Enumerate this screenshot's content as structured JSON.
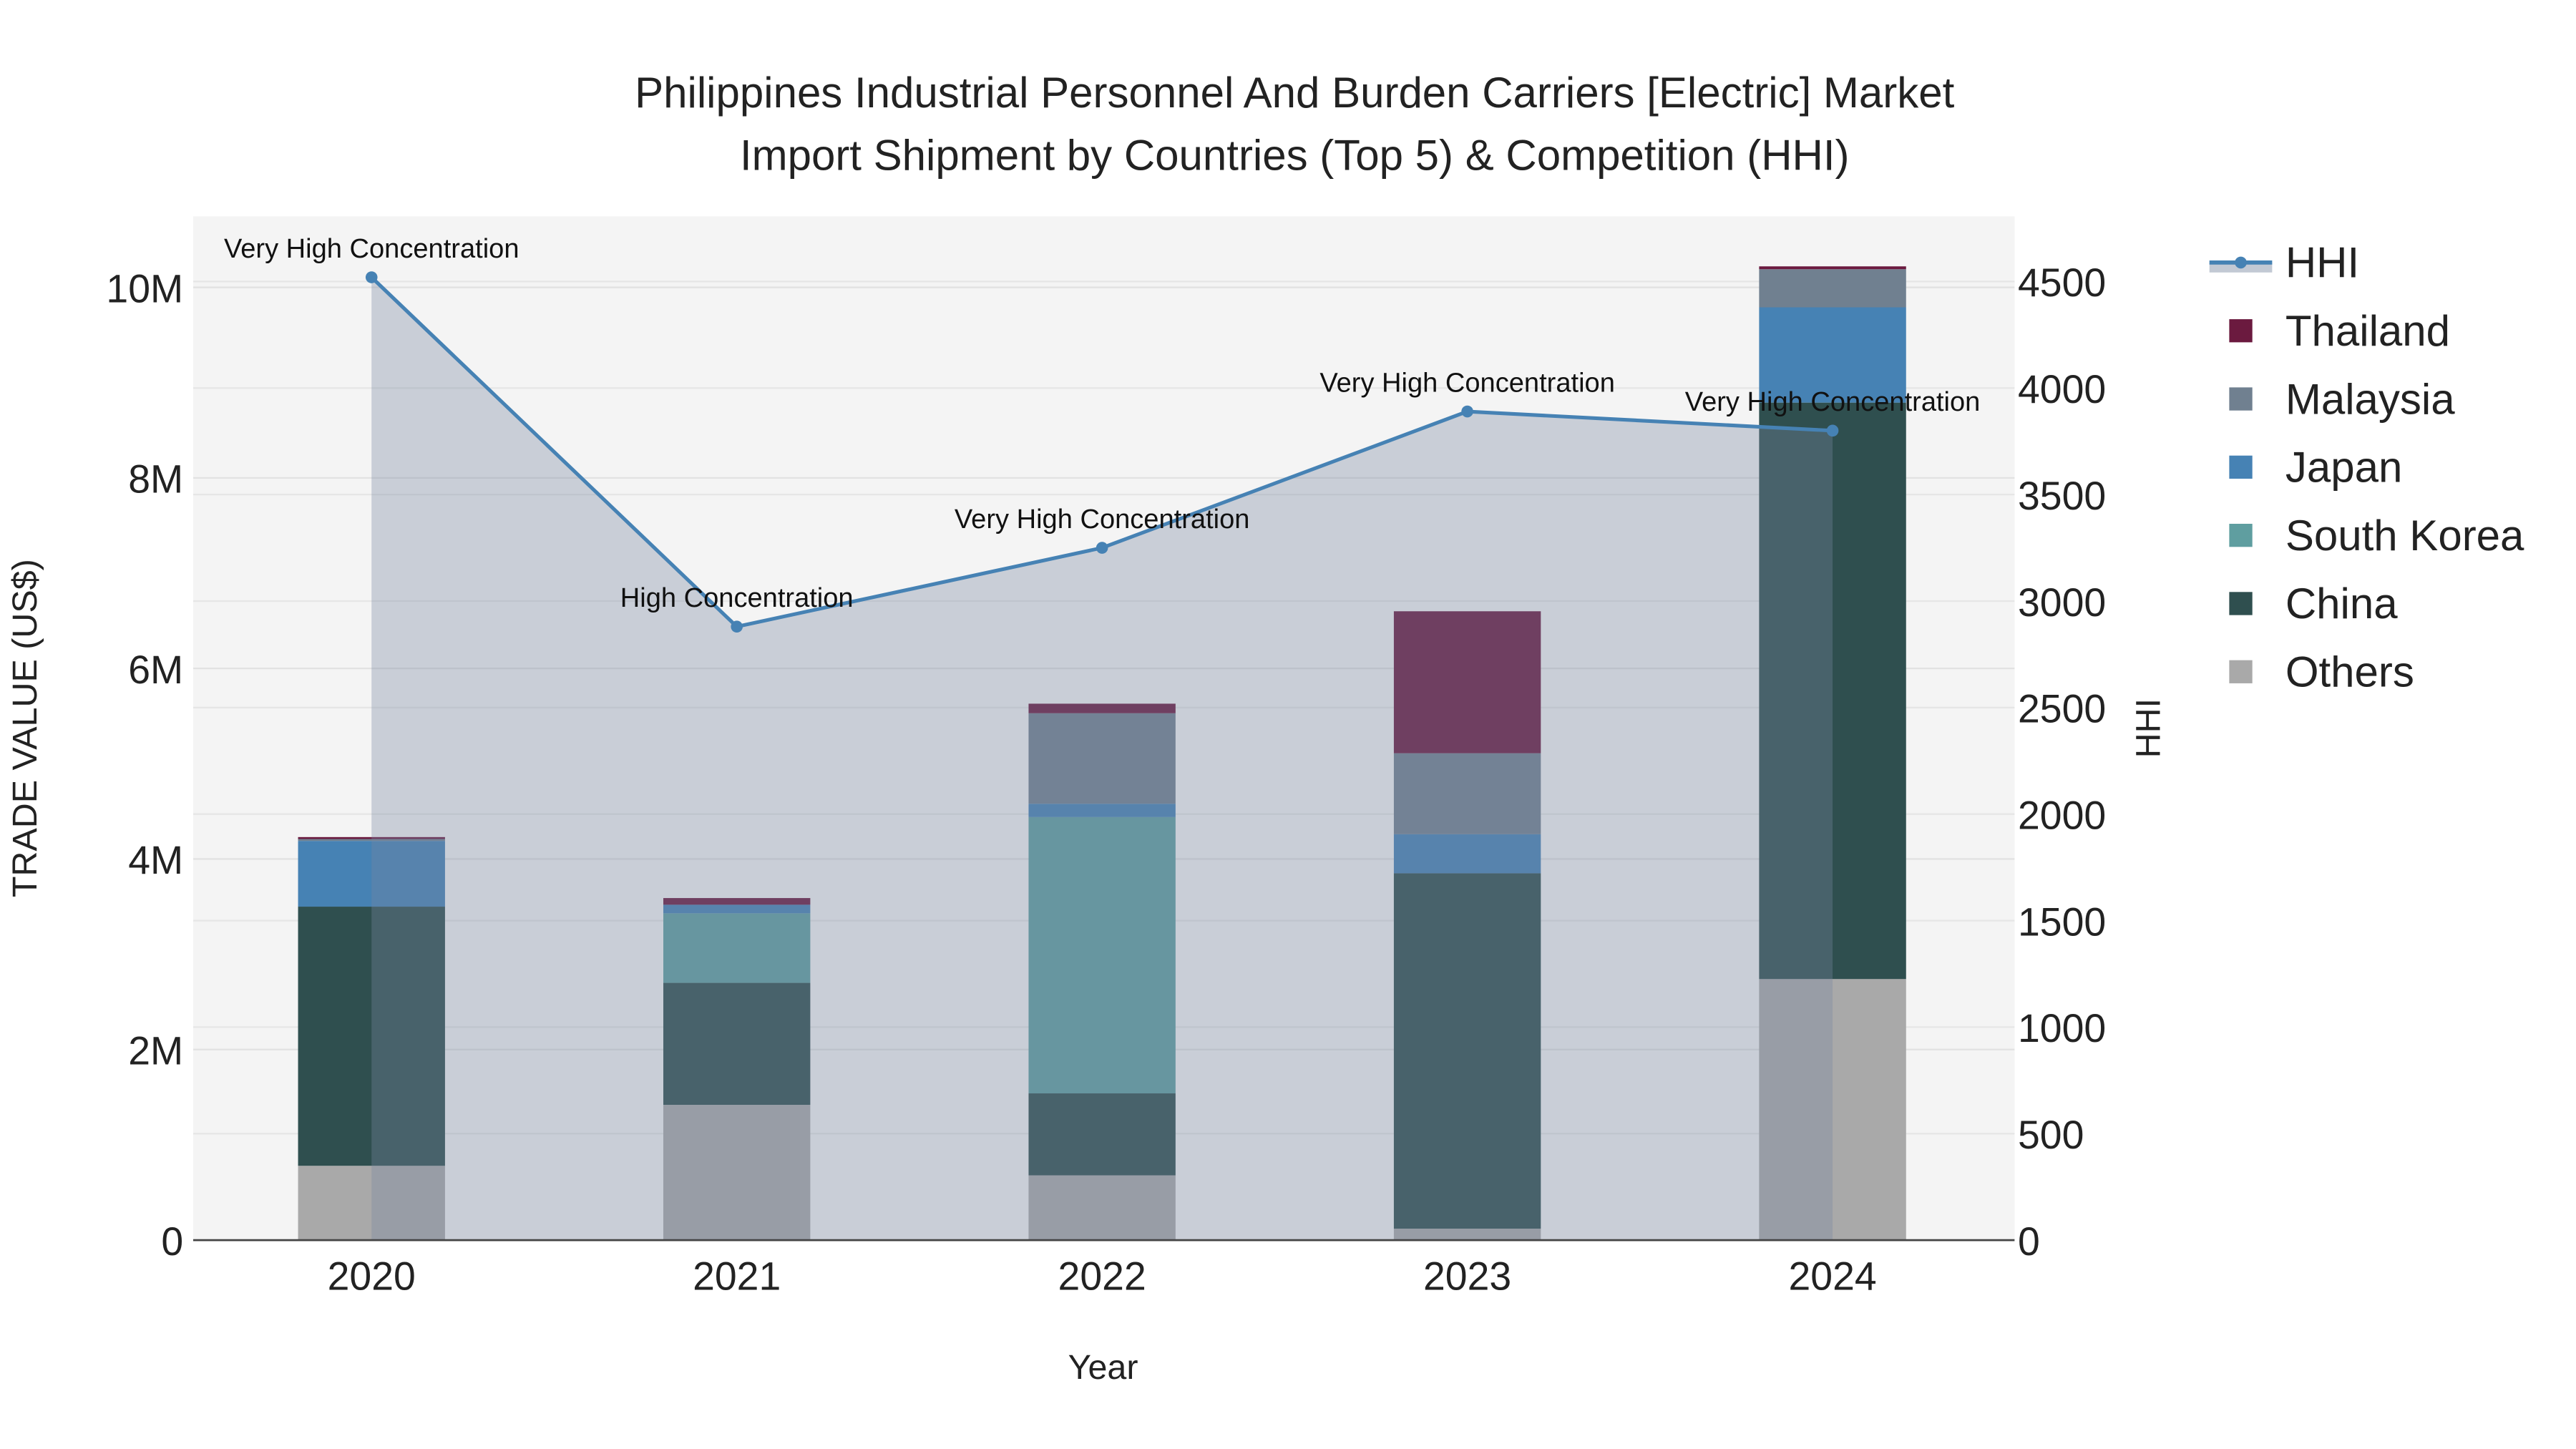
{
  "chart_data": {
    "type": "bar",
    "stacked": true,
    "title": "Philippines Industrial Personnel And Burden Carriers [Electric] Market",
    "subtitle": "Import Shipment by Countries (Top 5) & Competition (HHI)",
    "xlabel": "Year",
    "ylabel": "TRADE VALUE (US$)",
    "y2label": "HHI",
    "categories": [
      "2020",
      "2021",
      "2022",
      "2023",
      "2024"
    ],
    "ylim": [
      0,
      10700000
    ],
    "y2lim": [
      0,
      4800
    ],
    "yticks": [
      0,
      2000000,
      4000000,
      6000000,
      8000000,
      10000000
    ],
    "ytick_labels": [
      "0",
      "2M",
      "4M",
      "6M",
      "8M",
      "10M"
    ],
    "y2ticks": [
      0,
      500,
      1000,
      1500,
      2000,
      2500,
      3000,
      3500,
      4000,
      4500
    ],
    "y2tick_labels": [
      "0",
      "500",
      "1000",
      "1500",
      "2000",
      "2500",
      "3000",
      "3500",
      "4000",
      "4500"
    ],
    "series": [
      {
        "name": "Others",
        "color": "#a9a9a9",
        "values": [
          780000,
          1420000,
          680000,
          120000,
          2740000
        ]
      },
      {
        "name": "China",
        "color": "#2f4f4f",
        "values": [
          2720000,
          1280000,
          860000,
          3730000,
          6050000
        ]
      },
      {
        "name": "South Korea",
        "color": "#5f9ea0",
        "values": [
          0,
          730000,
          2900000,
          0,
          0
        ]
      },
      {
        "name": "Japan",
        "color": "#4682b4",
        "values": [
          690000,
          90000,
          140000,
          410000,
          1000000
        ]
      },
      {
        "name": "Malaysia",
        "color": "#708090",
        "values": [
          20000,
          0,
          950000,
          850000,
          400000
        ]
      },
      {
        "name": "Thailand",
        "color": "#6b1a3f",
        "values": [
          20000,
          70000,
          100000,
          1490000,
          30000
        ]
      }
    ],
    "hhi": {
      "name": "HHI",
      "color": "#4682b4",
      "values": [
        4520,
        2880,
        3250,
        3890,
        3800
      ],
      "labels": [
        "Very High Concentration",
        "High Concentration",
        "Very High Concentration",
        "Very High Concentration",
        "Very High Concentration"
      ]
    },
    "legend_order": [
      "HHI",
      "Thailand",
      "Malaysia",
      "Japan",
      "South Korea",
      "China",
      "Others"
    ],
    "legend_placement": "right",
    "grid": true
  }
}
